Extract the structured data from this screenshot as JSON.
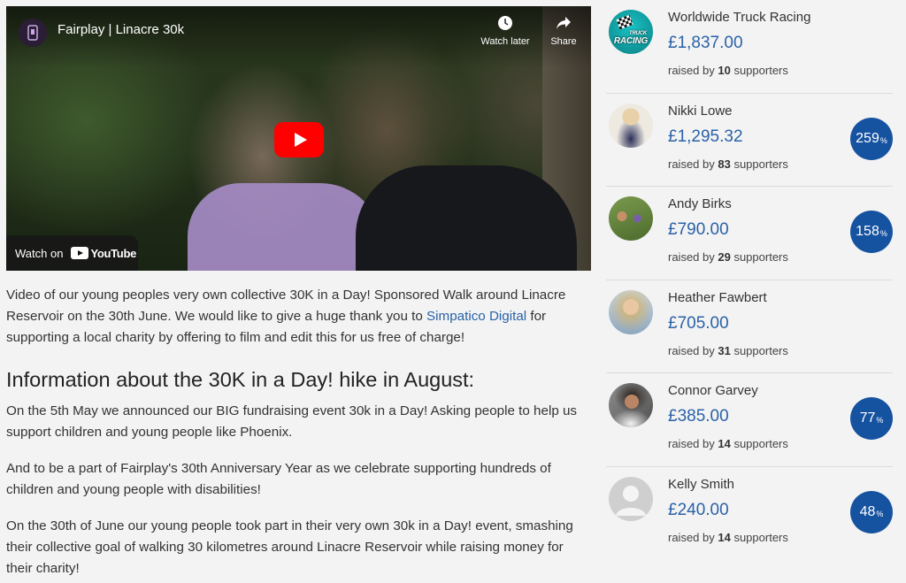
{
  "video": {
    "title": "Fairplay | Linacre 30k",
    "watch_later_label": "Watch later",
    "share_label": "Share",
    "watch_on_label": "Watch on",
    "brand_label": "YouTube"
  },
  "article": {
    "intro_before_link": "Video of our young peoples very own collective 30K in a Day! Sponsored Walk around Linacre Reservoir on the 30th June. We would like to give a huge thank you to ",
    "link_text": "Simpatico Digital",
    "intro_after_link": "  for supporting a local charity by offering to film and edit this for us free of charge!",
    "heading": "Information about the 30K in a Day! hike in August:",
    "paragraphs": [
      "On the 5th May we announced our BIG fundraising event  30k in a Day! Asking people to help us support children and young people like Phoenix.",
      "And to be a part of Fairplay's 30th Anniversary Year as we celebrate supporting hundreds of children and young people with disabilities!",
      "On the 30th of June our young people took part in their very own 30k in a Day! event, smashing their collective goal of walking 30 kilometres around Linacre Reservoir while raising money for their charity!"
    ]
  },
  "supporters": [
    {
      "name": "Worldwide Truck Racing",
      "amount": "£1,837.00",
      "raised_prefix": "raised by ",
      "count": "10",
      "raised_suffix": " supporters",
      "percent": "",
      "avatar_text": "RACING",
      "avatar_small": "TRUCK"
    },
    {
      "name": "Nikki Lowe",
      "amount": "£1,295.32",
      "raised_prefix": "raised by ",
      "count": "83",
      "raised_suffix": " supporters",
      "percent": "259",
      "percent_sign": "%"
    },
    {
      "name": "Andy Birks",
      "amount": "£790.00",
      "raised_prefix": "raised by ",
      "count": "29",
      "raised_suffix": " supporters",
      "percent": "158",
      "percent_sign": "%"
    },
    {
      "name": "Heather Fawbert",
      "amount": "£705.00",
      "raised_prefix": "raised by ",
      "count": "31",
      "raised_suffix": " supporters",
      "percent": "",
      "percent_sign": ""
    },
    {
      "name": "Connor Garvey",
      "amount": "£385.00",
      "raised_prefix": "raised by ",
      "count": "14",
      "raised_suffix": " supporters",
      "percent": "77",
      "percent_sign": "%"
    },
    {
      "name": "Kelly Smith",
      "amount": "£240.00",
      "raised_prefix": "raised by ",
      "count": "14",
      "raised_suffix": " supporters",
      "percent": "48",
      "percent_sign": "%"
    }
  ],
  "colors": {
    "link_blue": "#2a62a8",
    "badge_blue": "#1552a0",
    "play_red": "#ff0000",
    "page_bg": "#f3f3f3"
  }
}
